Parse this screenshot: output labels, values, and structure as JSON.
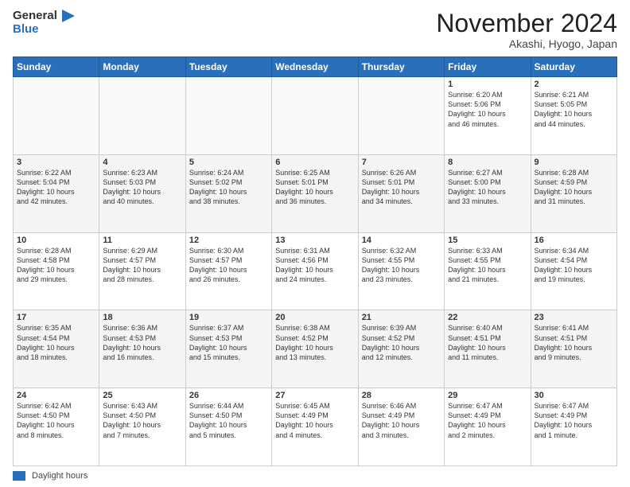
{
  "header": {
    "logo_general": "General",
    "logo_blue": "Blue",
    "month_title": "November 2024",
    "location": "Akashi, Hyogo, Japan"
  },
  "footer": {
    "legend_label": "Daylight hours"
  },
  "calendar": {
    "days_of_week": [
      "Sunday",
      "Monday",
      "Tuesday",
      "Wednesday",
      "Thursday",
      "Friday",
      "Saturday"
    ],
    "weeks": [
      [
        {
          "day": "",
          "info": ""
        },
        {
          "day": "",
          "info": ""
        },
        {
          "day": "",
          "info": ""
        },
        {
          "day": "",
          "info": ""
        },
        {
          "day": "",
          "info": ""
        },
        {
          "day": "1",
          "info": "Sunrise: 6:20 AM\nSunset: 5:06 PM\nDaylight: 10 hours\nand 46 minutes."
        },
        {
          "day": "2",
          "info": "Sunrise: 6:21 AM\nSunset: 5:05 PM\nDaylight: 10 hours\nand 44 minutes."
        }
      ],
      [
        {
          "day": "3",
          "info": "Sunrise: 6:22 AM\nSunset: 5:04 PM\nDaylight: 10 hours\nand 42 minutes."
        },
        {
          "day": "4",
          "info": "Sunrise: 6:23 AM\nSunset: 5:03 PM\nDaylight: 10 hours\nand 40 minutes."
        },
        {
          "day": "5",
          "info": "Sunrise: 6:24 AM\nSunset: 5:02 PM\nDaylight: 10 hours\nand 38 minutes."
        },
        {
          "day": "6",
          "info": "Sunrise: 6:25 AM\nSunset: 5:01 PM\nDaylight: 10 hours\nand 36 minutes."
        },
        {
          "day": "7",
          "info": "Sunrise: 6:26 AM\nSunset: 5:01 PM\nDaylight: 10 hours\nand 34 minutes."
        },
        {
          "day": "8",
          "info": "Sunrise: 6:27 AM\nSunset: 5:00 PM\nDaylight: 10 hours\nand 33 minutes."
        },
        {
          "day": "9",
          "info": "Sunrise: 6:28 AM\nSunset: 4:59 PM\nDaylight: 10 hours\nand 31 minutes."
        }
      ],
      [
        {
          "day": "10",
          "info": "Sunrise: 6:28 AM\nSunset: 4:58 PM\nDaylight: 10 hours\nand 29 minutes."
        },
        {
          "day": "11",
          "info": "Sunrise: 6:29 AM\nSunset: 4:57 PM\nDaylight: 10 hours\nand 28 minutes."
        },
        {
          "day": "12",
          "info": "Sunrise: 6:30 AM\nSunset: 4:57 PM\nDaylight: 10 hours\nand 26 minutes."
        },
        {
          "day": "13",
          "info": "Sunrise: 6:31 AM\nSunset: 4:56 PM\nDaylight: 10 hours\nand 24 minutes."
        },
        {
          "day": "14",
          "info": "Sunrise: 6:32 AM\nSunset: 4:55 PM\nDaylight: 10 hours\nand 23 minutes."
        },
        {
          "day": "15",
          "info": "Sunrise: 6:33 AM\nSunset: 4:55 PM\nDaylight: 10 hours\nand 21 minutes."
        },
        {
          "day": "16",
          "info": "Sunrise: 6:34 AM\nSunset: 4:54 PM\nDaylight: 10 hours\nand 19 minutes."
        }
      ],
      [
        {
          "day": "17",
          "info": "Sunrise: 6:35 AM\nSunset: 4:54 PM\nDaylight: 10 hours\nand 18 minutes."
        },
        {
          "day": "18",
          "info": "Sunrise: 6:36 AM\nSunset: 4:53 PM\nDaylight: 10 hours\nand 16 minutes."
        },
        {
          "day": "19",
          "info": "Sunrise: 6:37 AM\nSunset: 4:53 PM\nDaylight: 10 hours\nand 15 minutes."
        },
        {
          "day": "20",
          "info": "Sunrise: 6:38 AM\nSunset: 4:52 PM\nDaylight: 10 hours\nand 13 minutes."
        },
        {
          "day": "21",
          "info": "Sunrise: 6:39 AM\nSunset: 4:52 PM\nDaylight: 10 hours\nand 12 minutes."
        },
        {
          "day": "22",
          "info": "Sunrise: 6:40 AM\nSunset: 4:51 PM\nDaylight: 10 hours\nand 11 minutes."
        },
        {
          "day": "23",
          "info": "Sunrise: 6:41 AM\nSunset: 4:51 PM\nDaylight: 10 hours\nand 9 minutes."
        }
      ],
      [
        {
          "day": "24",
          "info": "Sunrise: 6:42 AM\nSunset: 4:50 PM\nDaylight: 10 hours\nand 8 minutes."
        },
        {
          "day": "25",
          "info": "Sunrise: 6:43 AM\nSunset: 4:50 PM\nDaylight: 10 hours\nand 7 minutes."
        },
        {
          "day": "26",
          "info": "Sunrise: 6:44 AM\nSunset: 4:50 PM\nDaylight: 10 hours\nand 5 minutes."
        },
        {
          "day": "27",
          "info": "Sunrise: 6:45 AM\nSunset: 4:49 PM\nDaylight: 10 hours\nand 4 minutes."
        },
        {
          "day": "28",
          "info": "Sunrise: 6:46 AM\nSunset: 4:49 PM\nDaylight: 10 hours\nand 3 minutes."
        },
        {
          "day": "29",
          "info": "Sunrise: 6:47 AM\nSunset: 4:49 PM\nDaylight: 10 hours\nand 2 minutes."
        },
        {
          "day": "30",
          "info": "Sunrise: 6:47 AM\nSunset: 4:49 PM\nDaylight: 10 hours\nand 1 minute."
        }
      ]
    ]
  }
}
